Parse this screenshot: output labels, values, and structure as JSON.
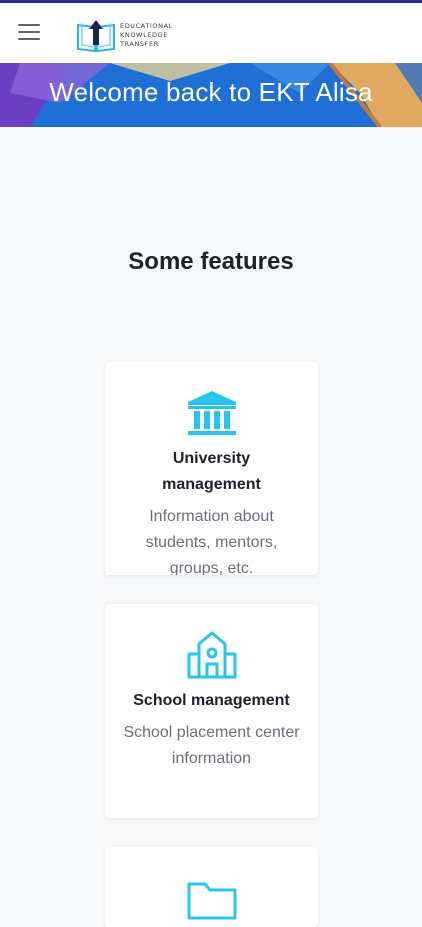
{
  "header": {
    "menu_icon": "hamburger-menu-icon",
    "logo_lines": [
      "EDUCATIONAL",
      "KNOWLEDGE",
      "TRANSFER"
    ]
  },
  "banner": {
    "title": "Welcome back to EKT Alisa"
  },
  "section": {
    "title": "Some features"
  },
  "features": [
    {
      "icon": "university-building-icon",
      "title": "University management",
      "description": "Information about students, mentors, groups, etc."
    },
    {
      "icon": "school-building-icon",
      "title": "School management",
      "description": "School placement center information"
    },
    {
      "icon": "folder-icon",
      "title": "",
      "description": ""
    }
  ],
  "colors": {
    "accent": "#29c4f0",
    "banner": "#1f6fd6",
    "top_line": "#2a2a9e"
  }
}
